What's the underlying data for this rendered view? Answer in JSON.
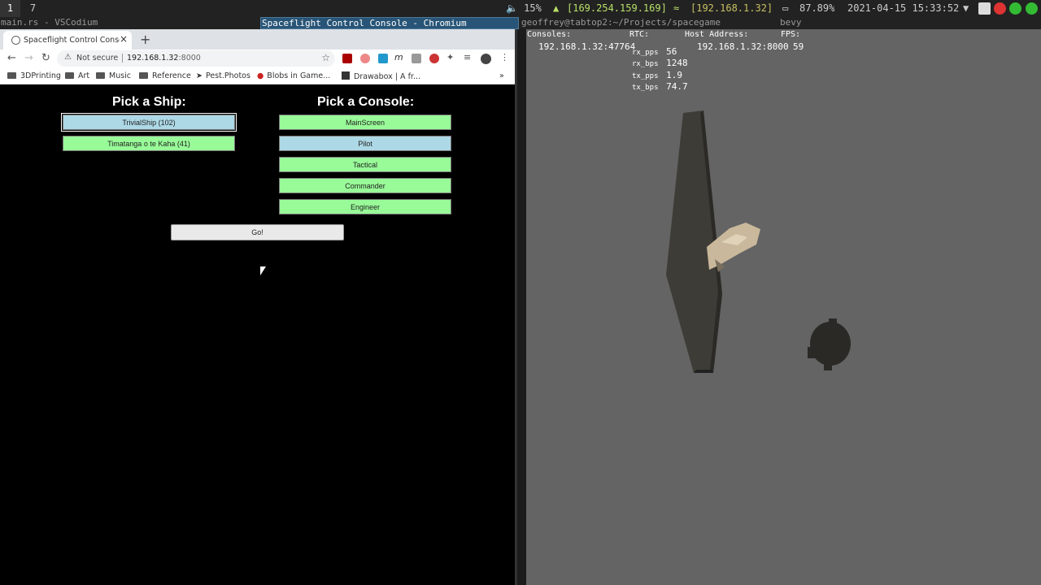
{
  "sysbar": {
    "workspaces": [
      "1",
      "7"
    ],
    "volume": "🔈 15%",
    "vpn": "[169.254.159.169]",
    "wifi": "[192.168.1.32]",
    "battery": "87.89%",
    "datetime": "2021-04-15 15:33:52"
  },
  "windows": {
    "editor_title": "main.rs - VSCodium",
    "browser_title": "Spaceflight Control Console - Chromium",
    "terminal_title": "geoffrey@tabtop2:~/Projects/spacegame",
    "game_title": "bevy"
  },
  "browser": {
    "tab_title": "Spaceflight Control Console",
    "tab_close": "×",
    "new_tab": "+",
    "security_label": "Not secure",
    "url_host": "192.168.1.32",
    "url_port": ":8000",
    "bookmarks": [
      "3DPrinting",
      "Art",
      "Music",
      "Reference",
      "Pest.Photos",
      "Blobs in Game...",
      "Drawabox | A fr..."
    ],
    "bookmarks_more": "»"
  },
  "page": {
    "ship_heading": "Pick a Ship:",
    "console_heading": "Pick a Console:",
    "ships": [
      {
        "label": "TrivialShip (102)",
        "state": "selected"
      },
      {
        "label": "Timatanga o te Kaha (41)",
        "state": "available"
      }
    ],
    "consoles": [
      {
        "label": "MainScreen",
        "state": "available"
      },
      {
        "label": "Pilot",
        "state": "selected"
      },
      {
        "label": "Tactical",
        "state": "available"
      },
      {
        "label": "Commander",
        "state": "available"
      },
      {
        "label": "Engineer",
        "state": "available"
      }
    ],
    "go_label": "Go!"
  },
  "hud": {
    "consoles_label": "Consoles:",
    "consoles_value": "192.168.1.32:47764",
    "rtc_label": "RTC:",
    "rx_pps_label": "rx_pps",
    "rx_pps": "56",
    "rx_bps_label": "rx_bps",
    "rx_bps": "1248",
    "tx_pps_label": "tx_pps",
    "tx_pps": "1.9",
    "tx_bps_label": "tx_bps",
    "tx_bps": "74.7",
    "host_label": "Host Address:",
    "host_value": "192.168.1.32:8000",
    "fps_label": "FPS:",
    "fps_value": "59"
  },
  "colors": {
    "available": "#98fb98",
    "selected": "#add8e6",
    "game_bg": "#646464",
    "active_title": "#285577"
  }
}
